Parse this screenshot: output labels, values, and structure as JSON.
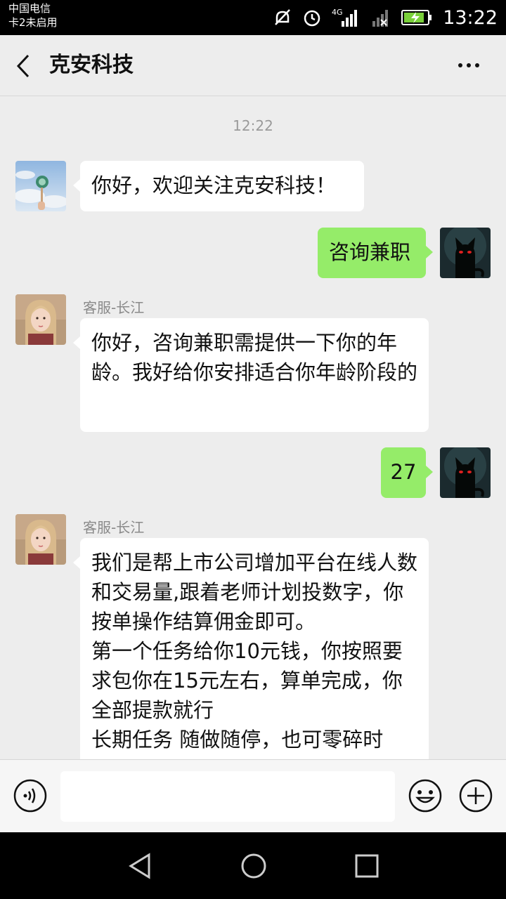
{
  "status_bar": {
    "carrier_line1": "中国电信",
    "carrier_line2": "卡2未启用",
    "network": "4G",
    "time": "13:22"
  },
  "header": {
    "title": "克安科技",
    "back_icon": "chevron-left-icon",
    "more_icon": "more-dots-icon"
  },
  "chat": {
    "timestamp": "12:22",
    "messages": [
      {
        "side": "left",
        "text": "你好，欢迎关注克安科技！"
      },
      {
        "side": "right",
        "text": "咨询兼职"
      },
      {
        "side": "left",
        "sender": "客服-长江",
        "text": "你好，咨询兼职需提供一下你的年龄。我好给你安排适合你年龄阶段的"
      },
      {
        "side": "right",
        "text": "27"
      },
      {
        "side": "left",
        "sender": "客服-长江",
        "lines": [
          "我们是帮上市公司增加平台在线人数和交易量,跟着老师计划投数字，你按单操作结算佣金即可。",
          "第一个任务给你10元钱，你按照要求包你在15元左右，算单完成，你全部提款就行",
          "长期任务 随做随停，也可零碎时"
        ]
      }
    ]
  },
  "input_bar": {
    "voice_icon": "voice-icon",
    "emoji_icon": "emoji-icon",
    "plus_icon": "plus-icon",
    "text_value": ""
  },
  "nav_bar": {
    "back_icon": "nav-back-icon",
    "home_icon": "nav-home-icon",
    "recents_icon": "nav-recents-icon"
  },
  "colors": {
    "self_bubble": "#95ec69",
    "other_bubble": "#ffffff",
    "background": "#ededed"
  }
}
